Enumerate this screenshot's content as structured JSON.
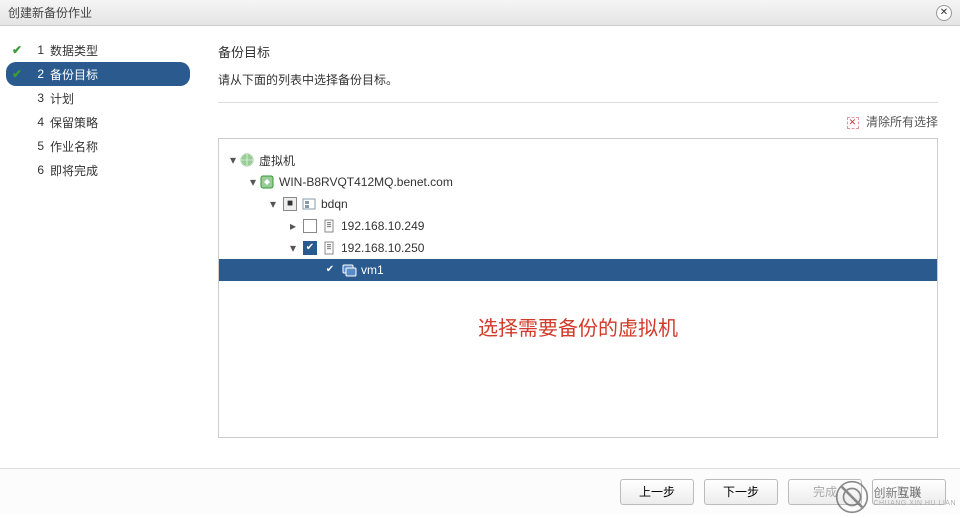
{
  "window": {
    "title": "创建新备份作业"
  },
  "steps": [
    {
      "num": "1",
      "label": "数据类型",
      "done": true,
      "active": false
    },
    {
      "num": "2",
      "label": "备份目标",
      "done": true,
      "active": true
    },
    {
      "num": "3",
      "label": "计划",
      "done": false,
      "active": false
    },
    {
      "num": "4",
      "label": "保留策略",
      "done": false,
      "active": false
    },
    {
      "num": "5",
      "label": "作业名称",
      "done": false,
      "active": false
    },
    {
      "num": "6",
      "label": "即将完成",
      "done": false,
      "active": false
    }
  ],
  "main": {
    "heading": "备份目标",
    "subheading": "请从下面的列表中选择备份目标。",
    "clear_label": "清除所有选择",
    "annotation": "选择需要备份的虚拟机"
  },
  "tree": {
    "root_label": "虚拟机",
    "host_label": "WIN-B8RVQT412MQ.benet.com",
    "dc_label": "bdqn",
    "ip1_label": "192.168.10.249",
    "ip2_label": "192.168.10.250",
    "vm1_label": "vm1",
    "ip1_checked": false,
    "ip2_checked": true,
    "vm1_checked": true
  },
  "footer": {
    "prev": "上一步",
    "next": "下一步",
    "finish": "完成",
    "cancel": "取消"
  },
  "watermark": {
    "brand": "创新互联"
  }
}
